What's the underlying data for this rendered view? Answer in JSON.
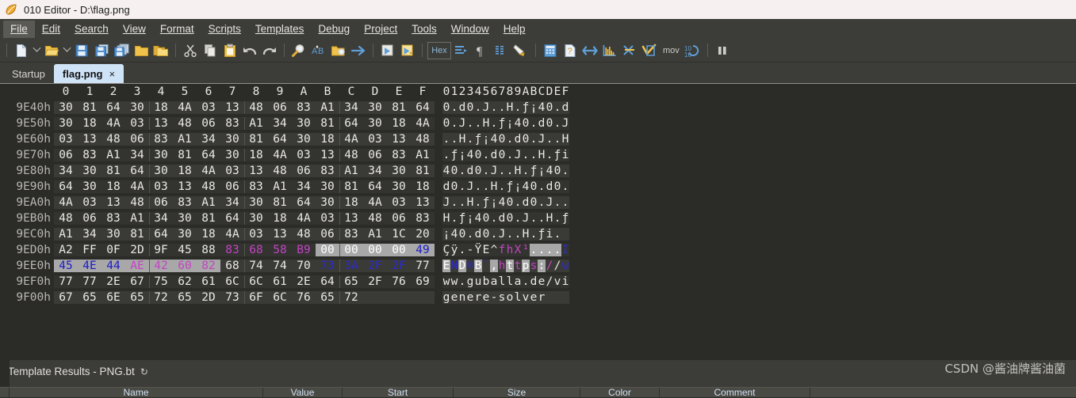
{
  "window": {
    "title": "010 Editor - D:\\flag.png",
    "icon": "010-editor-icon"
  },
  "menubar": {
    "items": [
      {
        "label": "File",
        "accel": "F",
        "active": true
      },
      {
        "label": "Edit",
        "accel": "E",
        "active": false
      },
      {
        "label": "Search",
        "accel": "S",
        "active": false
      },
      {
        "label": "View",
        "accel": "V",
        "active": false
      },
      {
        "label": "Format",
        "accel": "o",
        "active": false
      },
      {
        "label": "Scripts",
        "accel": "",
        "active": false
      },
      {
        "label": "Templates",
        "accel": "l",
        "active": false
      },
      {
        "label": "Debug",
        "accel": "D",
        "active": false
      },
      {
        "label": "Project",
        "accel": "P",
        "active": false
      },
      {
        "label": "Tools",
        "accel": "T",
        "active": false
      },
      {
        "label": "Window",
        "accel": "W",
        "active": false
      },
      {
        "label": "Help",
        "accel": "H",
        "active": false
      }
    ]
  },
  "toolbar": {
    "hex_button_label": "Hex",
    "mov_label": "mov",
    "buttons": [
      "new-file-icon",
      "new-file-dropdown-icon",
      "open-file-icon",
      "open-file-dropdown-icon",
      "save-icon",
      "save-as-icon",
      "save-all-icon",
      "open-folder-icon",
      "open-project-icon",
      "cut-icon",
      "copy-icon",
      "paste-icon",
      "undo-icon",
      "redo-icon",
      "find-icon",
      "replace-icon",
      "find-in-files-icon",
      "goto-icon",
      "run-script-icon",
      "run-template-icon",
      "hex-mode-button",
      "indent-icon",
      "paragraph-marks-icon",
      "column-mode-icon",
      "highlight-icon",
      "calculator-icon",
      "inspector-icon",
      "compare-icon",
      "histogram-icon",
      "checksum-icon",
      "checkmark-script-icon",
      "mov-label",
      "base-convert-icon",
      "pause-icon"
    ]
  },
  "tabs": {
    "items": [
      {
        "label": "Startup",
        "selected": false,
        "closable": false
      },
      {
        "label": "flag.png",
        "selected": true,
        "closable": true,
        "close_glyph": "×"
      }
    ]
  },
  "hex_editor": {
    "column_header": [
      "0",
      "1",
      "2",
      "3",
      "4",
      "5",
      "6",
      "7",
      "8",
      "9",
      "A",
      "B",
      "C",
      "D",
      "E",
      "F"
    ],
    "ascii_header": "0123456789ABCDEF",
    "rows": [
      {
        "addr": "9E40h",
        "bytes": [
          "30",
          "81",
          "64",
          "30",
          "18",
          "4A",
          "03",
          "13",
          "48",
          "06",
          "83",
          "A1",
          "34",
          "30",
          "81",
          "64"
        ],
        "ascii": "0.d0.J..H.ƒ¡40.d",
        "byte_styles": [
          "d",
          "d",
          "d",
          "d",
          "d",
          "d",
          "d",
          "d",
          "d",
          "d",
          "d",
          "d",
          "d",
          "d",
          "d",
          "d"
        ],
        "ascii_styles": "dddddddddddddddd"
      },
      {
        "addr": "9E50h",
        "bytes": [
          "30",
          "18",
          "4A",
          "03",
          "13",
          "48",
          "06",
          "83",
          "A1",
          "34",
          "30",
          "81",
          "64",
          "30",
          "18",
          "4A"
        ],
        "ascii": "0.J..H.ƒ¡40.d0.J",
        "byte_styles": [
          "d",
          "d",
          "d",
          "d",
          "d",
          "d",
          "d",
          "d",
          "d",
          "d",
          "d",
          "d",
          "d",
          "d",
          "d",
          "d"
        ],
        "ascii_styles": "dddddddddddddddd"
      },
      {
        "addr": "9E60h",
        "bytes": [
          "03",
          "13",
          "48",
          "06",
          "83",
          "A1",
          "34",
          "30",
          "81",
          "64",
          "30",
          "18",
          "4A",
          "03",
          "13",
          "48"
        ],
        "ascii": "..H.ƒ¡40.d0.J..H",
        "byte_styles": [
          "d",
          "d",
          "d",
          "d",
          "d",
          "d",
          "d",
          "d",
          "d",
          "d",
          "d",
          "d",
          "d",
          "d",
          "d",
          "d"
        ],
        "ascii_styles": "dddddddddddddddd"
      },
      {
        "addr": "9E70h",
        "bytes": [
          "06",
          "83",
          "A1",
          "34",
          "30",
          "81",
          "64",
          "30",
          "18",
          "4A",
          "03",
          "13",
          "48",
          "06",
          "83",
          "A1"
        ],
        "ascii": ".ƒ¡40.d0.J..H.ƒi",
        "byte_styles": [
          "d",
          "d",
          "d",
          "d",
          "d",
          "d",
          "d",
          "d",
          "d",
          "d",
          "d",
          "d",
          "d",
          "d",
          "d",
          "d"
        ],
        "ascii_styles": "dddddddddddddddd"
      },
      {
        "addr": "9E80h",
        "bytes": [
          "34",
          "30",
          "81",
          "64",
          "30",
          "18",
          "4A",
          "03",
          "13",
          "48",
          "06",
          "83",
          "A1",
          "34",
          "30",
          "81"
        ],
        "ascii": "40.d0.J..H.ƒ¡40.",
        "byte_styles": [
          "d",
          "d",
          "d",
          "d",
          "d",
          "d",
          "d",
          "d",
          "d",
          "d",
          "d",
          "d",
          "d",
          "d",
          "d",
          "d"
        ],
        "ascii_styles": "dddddddddddddddd"
      },
      {
        "addr": "9E90h",
        "bytes": [
          "64",
          "30",
          "18",
          "4A",
          "03",
          "13",
          "48",
          "06",
          "83",
          "A1",
          "34",
          "30",
          "81",
          "64",
          "30",
          "18"
        ],
        "ascii": "d0.J..H.ƒ¡40.d0.",
        "byte_styles": [
          "d",
          "d",
          "d",
          "d",
          "d",
          "d",
          "d",
          "d",
          "d",
          "d",
          "d",
          "d",
          "d",
          "d",
          "d",
          "d"
        ],
        "ascii_styles": "dddddddddddddddd"
      },
      {
        "addr": "9EA0h",
        "bytes": [
          "4A",
          "03",
          "13",
          "48",
          "06",
          "83",
          "A1",
          "34",
          "30",
          "81",
          "64",
          "30",
          "18",
          "4A",
          "03",
          "13"
        ],
        "ascii": "J..H.ƒ¡40.d0.J..",
        "byte_styles": [
          "d",
          "d",
          "d",
          "d",
          "d",
          "d",
          "d",
          "d",
          "d",
          "d",
          "d",
          "d",
          "d",
          "d",
          "d",
          "d"
        ],
        "ascii_styles": "dddddddddddddddd"
      },
      {
        "addr": "9EB0h",
        "bytes": [
          "48",
          "06",
          "83",
          "A1",
          "34",
          "30",
          "81",
          "64",
          "30",
          "18",
          "4A",
          "03",
          "13",
          "48",
          "06",
          "83"
        ],
        "ascii": "H.ƒ¡40.d0.J..H.ƒ",
        "byte_styles": [
          "d",
          "d",
          "d",
          "d",
          "d",
          "d",
          "d",
          "d",
          "d",
          "d",
          "d",
          "d",
          "d",
          "d",
          "d",
          "d"
        ],
        "ascii_styles": "dddddddddddddddd"
      },
      {
        "addr": "9EC0h",
        "bytes": [
          "A1",
          "34",
          "30",
          "81",
          "64",
          "30",
          "18",
          "4A",
          "03",
          "13",
          "48",
          "06",
          "83",
          "A1",
          "1C",
          "20"
        ],
        "ascii": "¡40.d0.J..H.ƒi.",
        "byte_styles": [
          "d",
          "d",
          "d",
          "d",
          "d",
          "d",
          "d",
          "d",
          "d",
          "d",
          "d",
          "d",
          "d",
          "d",
          "d",
          "d"
        ],
        "ascii_styles": "dddddddddddddddd"
      },
      {
        "addr": "9ED0h",
        "bytes": [
          "A2",
          "FF",
          "0F",
          "2D",
          "9F",
          "45",
          "88",
          "83",
          "68",
          "58",
          "B9",
          "00",
          "00",
          "00",
          "00",
          "49"
        ],
        "ascii": "Çÿ.-ŸE^fhX¹....I",
        "byte_styles": [
          "d",
          "d",
          "d",
          "d",
          "d",
          "d",
          "d",
          "m",
          "m",
          "m",
          "m",
          "sd",
          "sd",
          "sd",
          "sd",
          "sb"
        ],
        "ascii_styles": "dddddddmmmmssssb"
      },
      {
        "addr": "9EE0h",
        "bytes": [
          "45",
          "4E",
          "44",
          "AE",
          "42",
          "60",
          "82",
          "68",
          "74",
          "74",
          "70",
          "73",
          "3A",
          "2F",
          "2F",
          "77"
        ],
        "ascii": "END®B`,https://w",
        "byte_styles": [
          "sb",
          "sb",
          "sb",
          "sm",
          "sm",
          "sm",
          "sm",
          "d",
          "d",
          "d",
          "d",
          "b",
          "b",
          "b",
          "b",
          "d"
        ],
        "ascii_styles": "sbsbsbsmsmsmsmdbbbbbbbd"
      },
      {
        "addr": "9EF0h",
        "bytes": [
          "77",
          "77",
          "2E",
          "67",
          "75",
          "62",
          "61",
          "6C",
          "6C",
          "61",
          "2E",
          "64",
          "65",
          "2F",
          "76",
          "69"
        ],
        "ascii": "ww.guballa.de/vi",
        "byte_styles": [
          "d",
          "d",
          "d",
          "d",
          "d",
          "d",
          "d",
          "d",
          "d",
          "d",
          "d",
          "d",
          "d",
          "d",
          "d",
          "d"
        ],
        "ascii_styles": "dddddddddddddddd"
      },
      {
        "addr": "9F00h",
        "bytes": [
          "67",
          "65",
          "6E",
          "65",
          "72",
          "65",
          "2D",
          "73",
          "6F",
          "6C",
          "76",
          "65",
          "72",
          "",
          "",
          ""
        ],
        "ascii": "genere-solver",
        "byte_styles": [
          "d",
          "d",
          "d",
          "d",
          "d",
          "d",
          "d",
          "d",
          "d",
          "d",
          "d",
          "d",
          "d",
          "d",
          "d",
          "d"
        ],
        "ascii_styles": "ddddddddddddd"
      }
    ]
  },
  "template_results": {
    "title": "Template Results - PNG.bt",
    "refresh_icon": "refresh-icon",
    "columns": [
      "Name",
      "Value",
      "Start",
      "Size",
      "Color",
      "Comment"
    ]
  },
  "watermark": {
    "text": "CSDN @酱油牌酱油菌"
  },
  "colors": {
    "titlebar_bg": "#f6f0f0",
    "chrome_bg": "#3c3c38",
    "editor_bg": "#2b2b28",
    "stripe": "#3a3a36",
    "selection": "#a8a8a8",
    "magenta": "#c443c4",
    "blue": "#2b2bd0",
    "tab_selected": "#cfe3f7"
  }
}
